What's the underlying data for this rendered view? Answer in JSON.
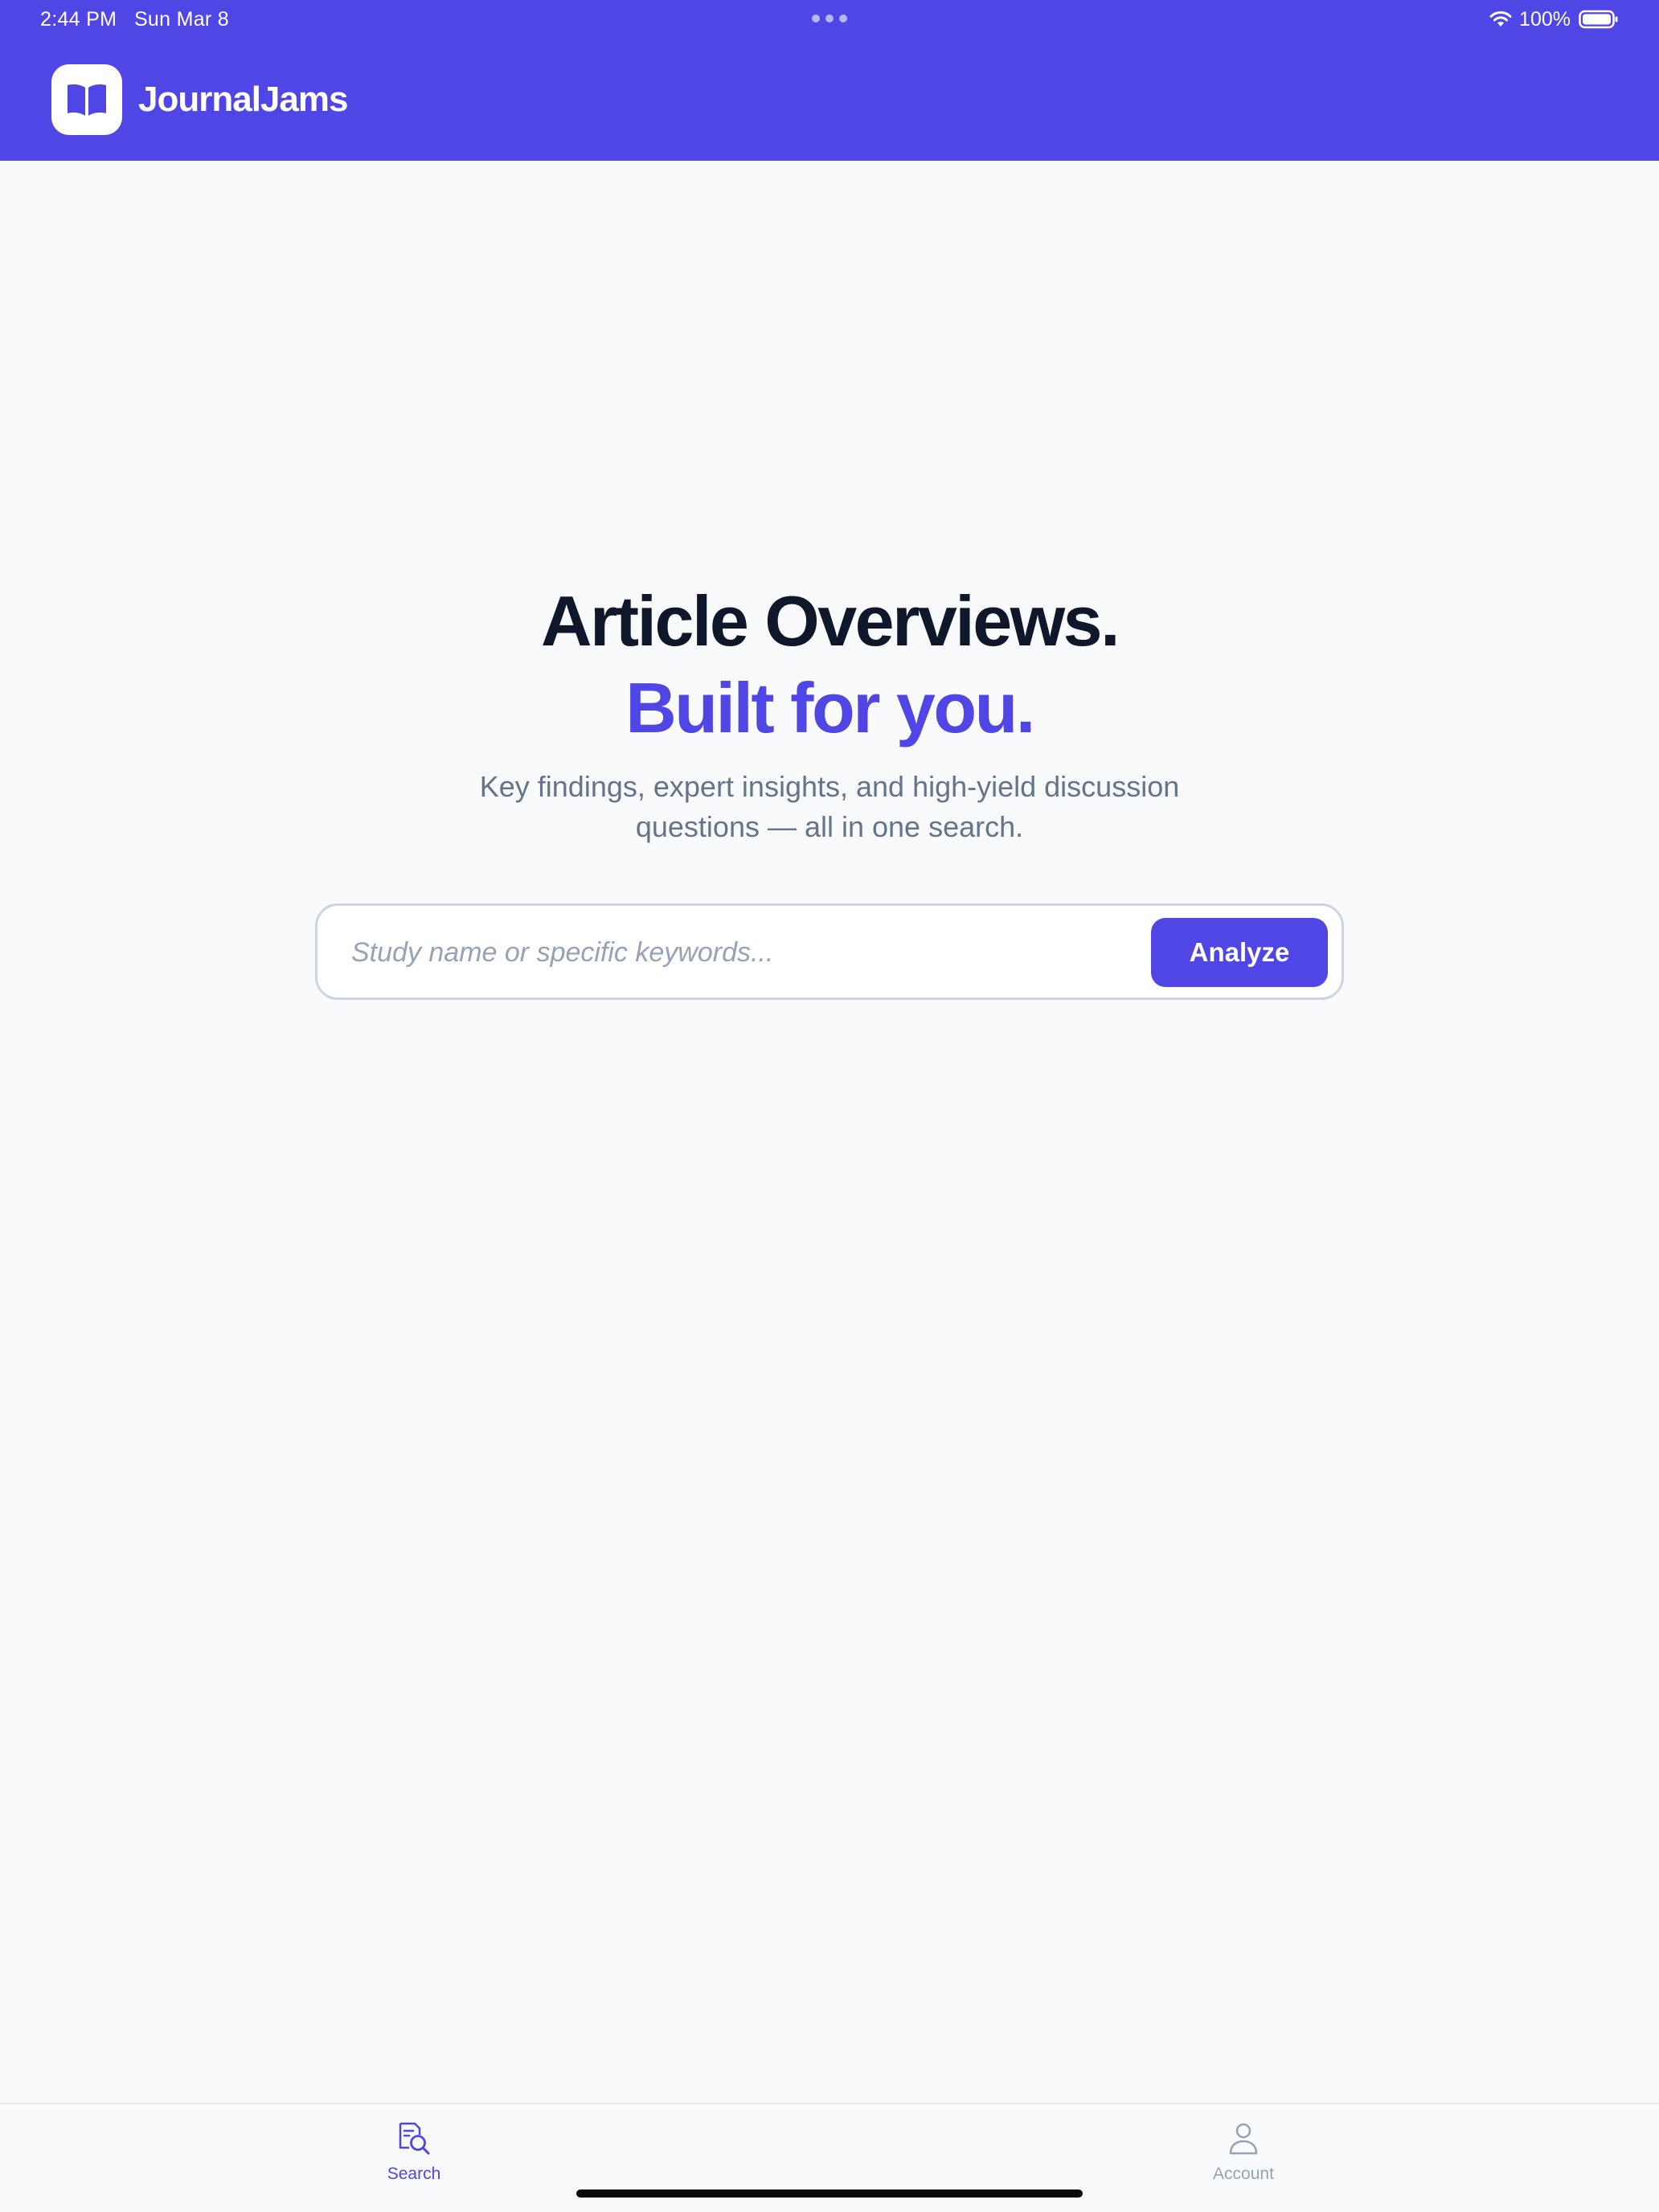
{
  "status_bar": {
    "time": "2:44 PM",
    "date": "Sun Mar 8",
    "battery": "100%",
    "icons": [
      "wifi-icon",
      "battery-icon",
      "multitasking-dots-icon"
    ]
  },
  "header": {
    "app_name": "JournalJams",
    "logo_icon": "open-book-icon",
    "background_color": "#4F46E5"
  },
  "hero": {
    "title": "Article Overviews.",
    "accent": "Built for you.",
    "subtitle": "Key findings, expert insights, and high-yield discussion questions — all in one search.",
    "accent_color": "#4F46E5"
  },
  "search": {
    "placeholder": "Study name or specific keywords...",
    "value": "",
    "button_label": "Analyze"
  },
  "tabs": [
    {
      "label": "Search",
      "icon": "search-document-icon",
      "active": true
    },
    {
      "label": "Account",
      "icon": "person-icon",
      "active": false
    }
  ],
  "colors": {
    "primary": "#4F46E5",
    "heading": "#0F172A",
    "muted": "#64748B",
    "inactive": "#94A3B8",
    "background": "#F8FAFC"
  }
}
